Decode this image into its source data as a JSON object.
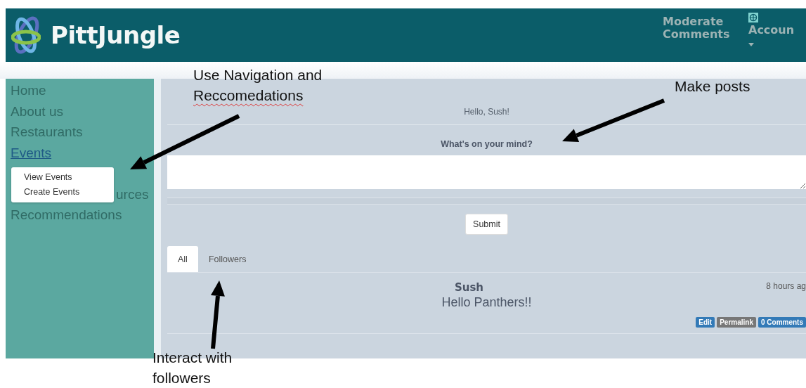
{
  "header": {
    "logo": "PittJungle",
    "moderate_link": "Moderate Comments",
    "account_link": "Accoun"
  },
  "sidebar": {
    "items": [
      {
        "label": "Home",
        "selected": false
      },
      {
        "label": "About us",
        "selected": false
      },
      {
        "label": "Restaurants",
        "selected": false
      },
      {
        "label": "Events",
        "selected": true,
        "submenu": [
          "View Events",
          "Create Events"
        ]
      },
      {
        "label": "urces",
        "selected": false,
        "covered": true
      },
      {
        "label": "Recommendations",
        "selected": false
      }
    ]
  },
  "main": {
    "greeting": "Hello, Sush!",
    "prompt": "What's on your mind?",
    "submit": "Submit",
    "tabs": [
      {
        "label": "All",
        "selected": true
      },
      {
        "label": "Followers",
        "selected": false
      }
    ],
    "posts": [
      {
        "author": "Sush",
        "time": "8 hours ag",
        "text": "Hello Panthers!!",
        "actions": [
          {
            "label": "Edit",
            "kind": "primary"
          },
          {
            "label": "Permalink",
            "kind": "default"
          },
          {
            "label": "0 Comments",
            "kind": "primary"
          }
        ]
      }
    ]
  },
  "annotations": [
    {
      "lines": [
        {
          "text": "Use Navigation and",
          "misspelled": false
        },
        {
          "text": "Reccomedations",
          "misspelled": true
        }
      ]
    },
    {
      "lines": [
        {
          "text": "Make posts",
          "misspelled": false
        }
      ]
    },
    {
      "lines": [
        {
          "text": "Interact with",
          "misspelled": false
        },
        {
          "text": "followers",
          "misspelled": false
        }
      ]
    }
  ]
}
